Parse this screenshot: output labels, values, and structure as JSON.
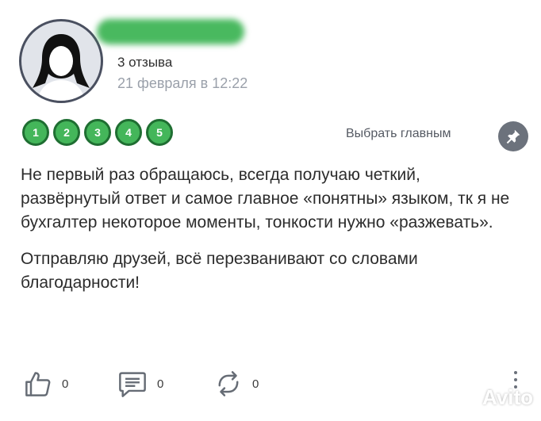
{
  "reviewer": {
    "avatar_icon": "user-avatar-icon",
    "reviews_count": "3 отзыва",
    "date": "21 февраля в 12:22"
  },
  "ratings": [
    "1",
    "2",
    "3",
    "4",
    "5"
  ],
  "main_link": "Выбрать главным",
  "pin_icon": "pin-icon",
  "review": {
    "paragraphs": [
      "Не первый раз обращаюсь, всегда получаю четкий, развёрнутый ответ и самое главное «понятны» языком, тк я не бухгалтер некоторое моменты, тонкости нужно «разжевать».",
      "Отправляю друзей, всё перезванивают со словами благодарности!"
    ]
  },
  "actions": {
    "like": {
      "icon": "thumbs-up-icon",
      "count": "0"
    },
    "comment": {
      "icon": "comment-icon",
      "count": "0"
    },
    "repost": {
      "icon": "repost-icon",
      "count": "0"
    },
    "more_icon": "more-vertical-icon"
  },
  "watermark": {
    "text": "Avito"
  },
  "colors": {
    "accent_green": "#44b65a",
    "date_gray": "#9aa0aa",
    "icon_gray": "#6c727c"
  }
}
